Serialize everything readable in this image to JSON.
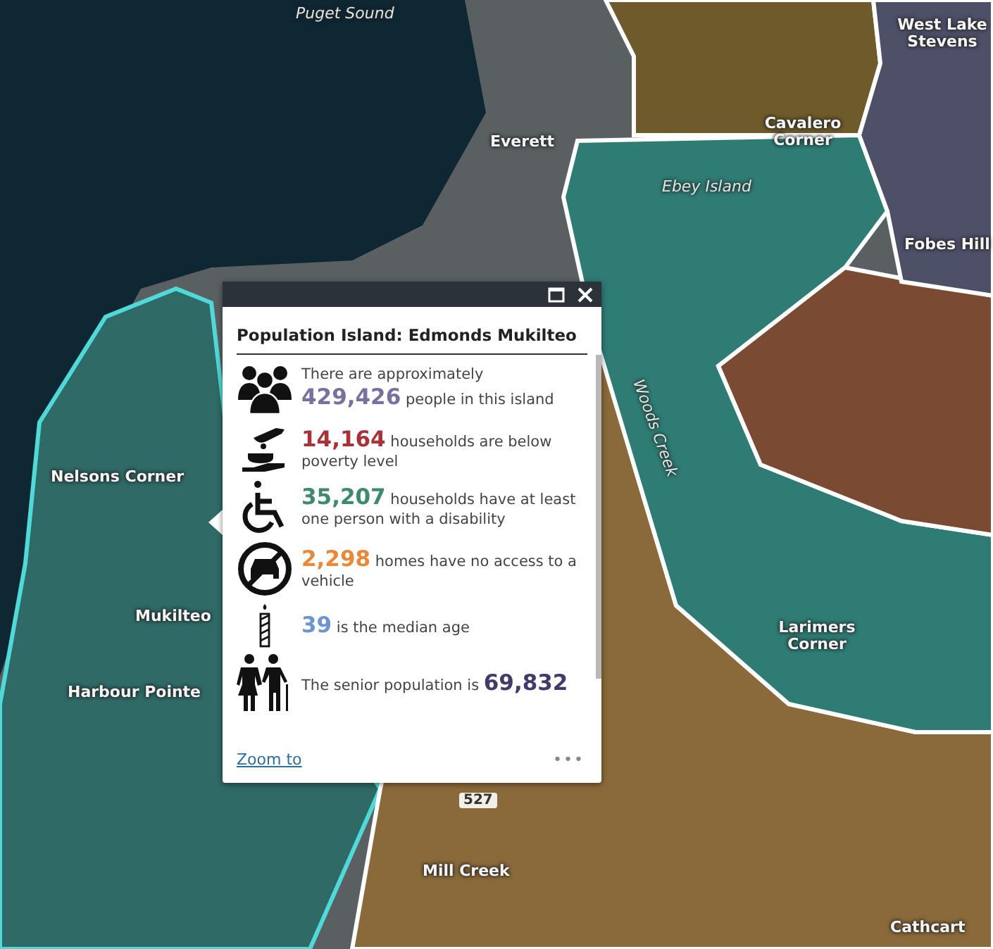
{
  "map": {
    "labels": [
      {
        "text": "Puget Sound",
        "kind": "water"
      },
      {
        "text": "Everett",
        "kind": "place"
      },
      {
        "text": "Cavalero Corner",
        "kind": "place"
      },
      {
        "text": "West Lake Stevens",
        "kind": "place"
      },
      {
        "text": "Ebey Island",
        "kind": "water"
      },
      {
        "text": "Fobes Hill",
        "kind": "place"
      },
      {
        "text": "Woods Creek",
        "kind": "water"
      },
      {
        "text": "Nelsons Corner",
        "kind": "place"
      },
      {
        "text": "Mukilteo",
        "kind": "place"
      },
      {
        "text": "Harbour Pointe",
        "kind": "place"
      },
      {
        "text": "Larimers Corner",
        "kind": "place"
      },
      {
        "text": "Mill Creek",
        "kind": "place"
      },
      {
        "text": "Cathcart",
        "kind": "place"
      },
      {
        "text": "527",
        "kind": "route"
      }
    ]
  },
  "popup": {
    "title": "Population Island: Edmonds Mukilteo",
    "stats": [
      {
        "prefix": "There are approximately",
        "value": "429,426",
        "suffix": "people in this island",
        "color": "#77719f"
      },
      {
        "value": "14,164",
        "suffix": "households are below poverty level",
        "color": "#a8323a"
      },
      {
        "value": "35,207",
        "suffix": "households have at least one person with a disability",
        "color": "#3f8a6a"
      },
      {
        "value": "2,298",
        "suffix": "homes have no access to a vehicle",
        "color": "#e8893a"
      },
      {
        "value": "39",
        "suffix": "is the median age",
        "color": "#6c95d0"
      },
      {
        "prefix": "The senior population is",
        "value": "69,832",
        "color": "#3f3c6b"
      }
    ],
    "zoom_link": "Zoom to",
    "menu": "•••"
  }
}
